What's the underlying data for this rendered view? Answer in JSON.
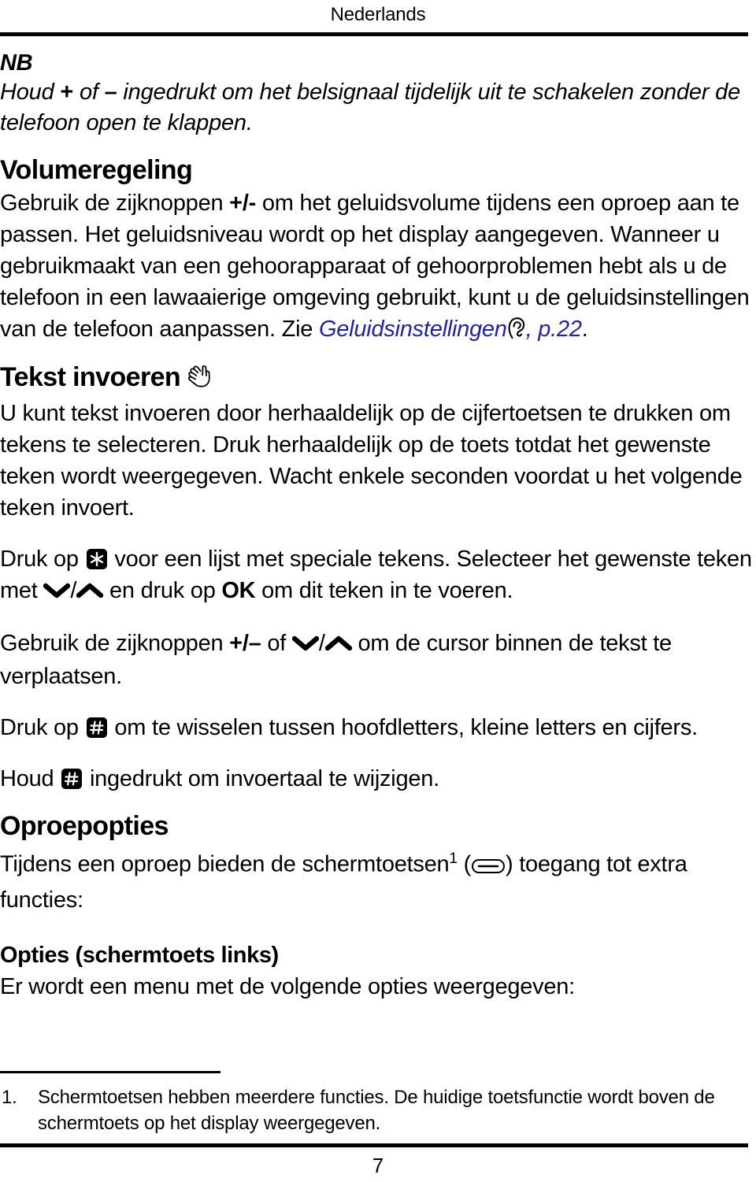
{
  "page": {
    "running_header": "Nederlands",
    "page_number": "7",
    "link_color": "#2222a8",
    "text_color": "#000000",
    "background": "#ffffff"
  },
  "note": {
    "label": "NB",
    "line1_a": "Houd ",
    "line1_plus": "+",
    "line1_b": " of ",
    "line1_minus": "–",
    "line1_c": " ingedrukt om het belsignaal tijdelijk uit te schakelen zonder de telefoon open te klappen."
  },
  "volume_section": {
    "heading": "Volumeregeling",
    "text_a": "Gebruik de zijknoppen ",
    "text_keys": "+/-",
    "text_b": " om het geluidsvolume tijdens een oproep aan te passen. Het geluidsniveau wordt op het display aangegeven. Wanneer u gebruikmaakt van een gehoorapparaat of gehoorproblemen hebt als u de telefoon in een lawaaierige omgeving gebruikt, kunt u de geluidsinstellingen van de telefoon aanpassen. Zie ",
    "link_label": "Geluidsinstellingen",
    "ear_icon": "ear-icon",
    "link_page": ", p.22",
    "text_end": "."
  },
  "text_entry_section": {
    "heading": "Tekst invoeren",
    "hand_icon": "hand-icon",
    "paragraph1": "U kunt tekst invoeren door herhaaldelijk op de cijfertoetsen te drukken om tekens te selecteren.  Druk herhaaldelijk op de toets totdat het gewenste teken wordt weergegeven. Wacht enkele seconden voordat u het volgende teken invoert.",
    "paragraph2_a": "Druk op ",
    "star_key": "star-key-icon",
    "paragraph2_b": " voor een lijst met speciale tekens.  Selecteer het gewenste teken met ",
    "chevron_down": "chevron-down-icon",
    "slash": "/",
    "chevron_up": "chevron-up-icon",
    "paragraph2_c": " en druk op ",
    "ok_label": "OK",
    "paragraph2_d": " om dit teken in te voeren.",
    "paragraph3_a": "Gebruik de zijknoppen ",
    "paragraph3_keys": "+/–",
    "paragraph3_b": " of ",
    "paragraph3_c": " om de cursor binnen de tekst te verplaatsen.",
    "paragraph4_a": "Druk op ",
    "hash_key": "hash-key-icon",
    "paragraph4_b": " om te wisselen tussen hoofdletters, kleine letters en cijfers.",
    "paragraph5_a": "Houd ",
    "paragraph5_b": " ingedrukt om invoertaal te wijzigen."
  },
  "call_options_section": {
    "heading": "Oproepopties",
    "intro_a": "Tijdens een oproep bieden de schermtoetsen",
    "footnote_marker": "1",
    "intro_b": " (",
    "softkey_icon": "softkey-icon",
    "intro_c": ") toegang tot extra functies:",
    "subheading": "Opties (schermtoets links)",
    "subtext": "Er wordt een menu met de volgende opties weergegeven:"
  },
  "footnote": {
    "number": "1.",
    "text": "Schermtoetsen hebben meerdere functies.  De huidige toetsfunctie wordt boven de schermtoets op het display weergegeven."
  }
}
